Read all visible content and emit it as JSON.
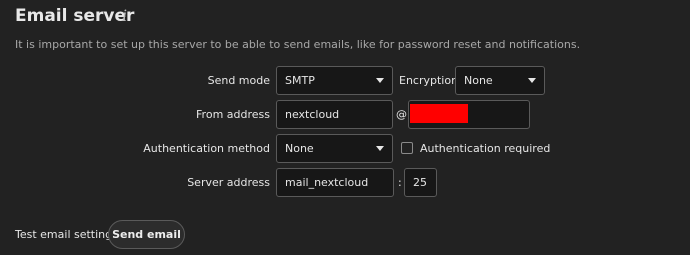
{
  "section": {
    "title": "Email server",
    "info_icon": "info-icon",
    "description": "It is important to set up this server to be able to send emails, like for password reset and notifications."
  },
  "send_mode": {
    "label": "Send mode",
    "value": "SMTP"
  },
  "encryption": {
    "label": "Encryption",
    "value": "None"
  },
  "from_address": {
    "label": "From address",
    "local_part": "nextcloud",
    "at_sign": "@",
    "domain_redaction_color": "#ff0000"
  },
  "authentication": {
    "method_label": "Authentication method",
    "method_value": "None",
    "required_label": "Authentication required",
    "required_checked": false
  },
  "server": {
    "label": "Server address",
    "host": "mail_nextcloud",
    "separator": ":",
    "port": "25"
  },
  "test": {
    "label": "Test email settings",
    "button_label": "Send email"
  },
  "colors": {
    "background": "#222222",
    "field_background": "#171717",
    "field_border": "#5a5a5a"
  }
}
